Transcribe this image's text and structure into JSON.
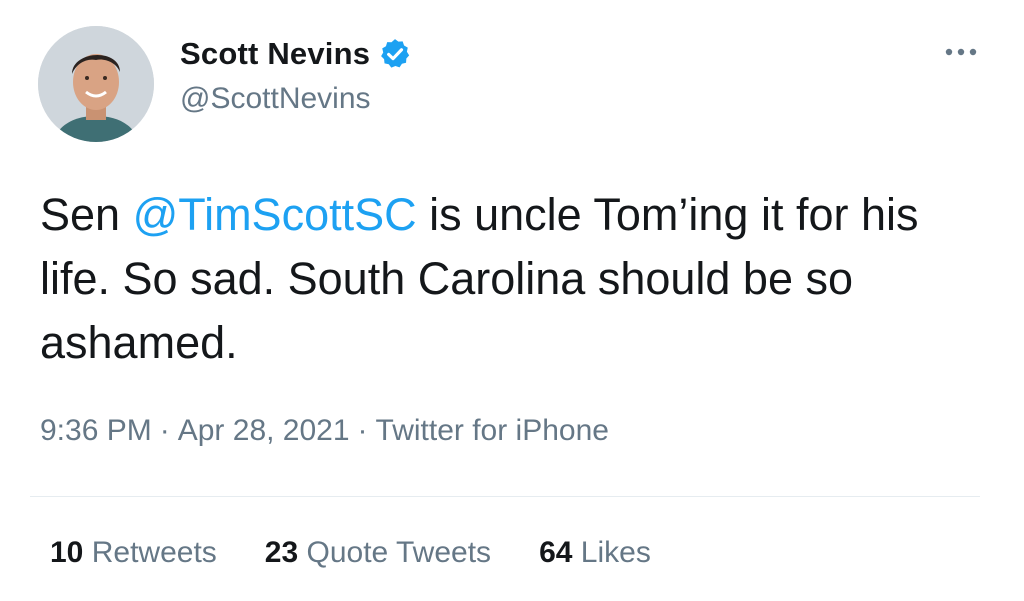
{
  "author": {
    "display_name": "Scott Nevins",
    "handle": "@ScottNevins",
    "verified": true,
    "avatar_icon": "profile-photo"
  },
  "more_icon": "ellipsis-icon",
  "tweet": {
    "text_before": "Sen ",
    "mention": "@TimScottSC",
    "text_after": " is uncle Tom’ing it for his life. So sad. South Carolina should be so ashamed."
  },
  "meta": {
    "time": "9:36 PM",
    "separator": "·",
    "date": "Apr 28, 2021",
    "source": "Twitter for iPhone"
  },
  "stats": {
    "retweets": {
      "count": "10",
      "label": "Retweets"
    },
    "quote_tweets": {
      "count": "23",
      "label": "Quote Tweets"
    },
    "likes": {
      "count": "64",
      "label": "Likes"
    }
  },
  "colors": {
    "link": "#1da1f2",
    "secondary_text": "#657786",
    "primary_text": "#14171a",
    "verified_badge": "#1da1f2"
  }
}
